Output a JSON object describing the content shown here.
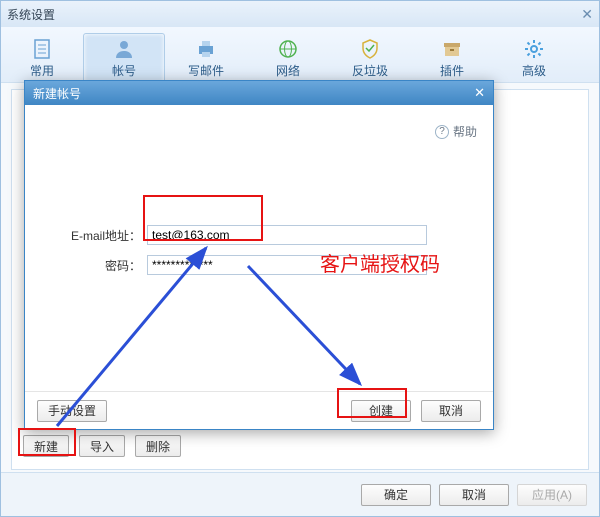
{
  "outer": {
    "title": "系统设置",
    "footer": {
      "ok": "确定",
      "cancel": "取消",
      "apply": "应用(A)"
    }
  },
  "toolbar": {
    "items": [
      {
        "label": "常用"
      },
      {
        "label": "帐号"
      },
      {
        "label": "写邮件"
      },
      {
        "label": "网络"
      },
      {
        "label": "反垃圾"
      },
      {
        "label": "插件"
      },
      {
        "label": "高级"
      }
    ]
  },
  "bottom": {
    "new": "新建",
    "import": "导入",
    "delete": "删除"
  },
  "modal": {
    "title": "新建帐号",
    "help": "帮助",
    "email_label": "E-mail地址：",
    "email_value": "test@163.com",
    "pwd_label": "密码：",
    "pwd_value": "*************",
    "manual": "手动设置",
    "create": "创建",
    "cancel": "取消"
  },
  "annotation": {
    "note": "客户端授权码"
  }
}
